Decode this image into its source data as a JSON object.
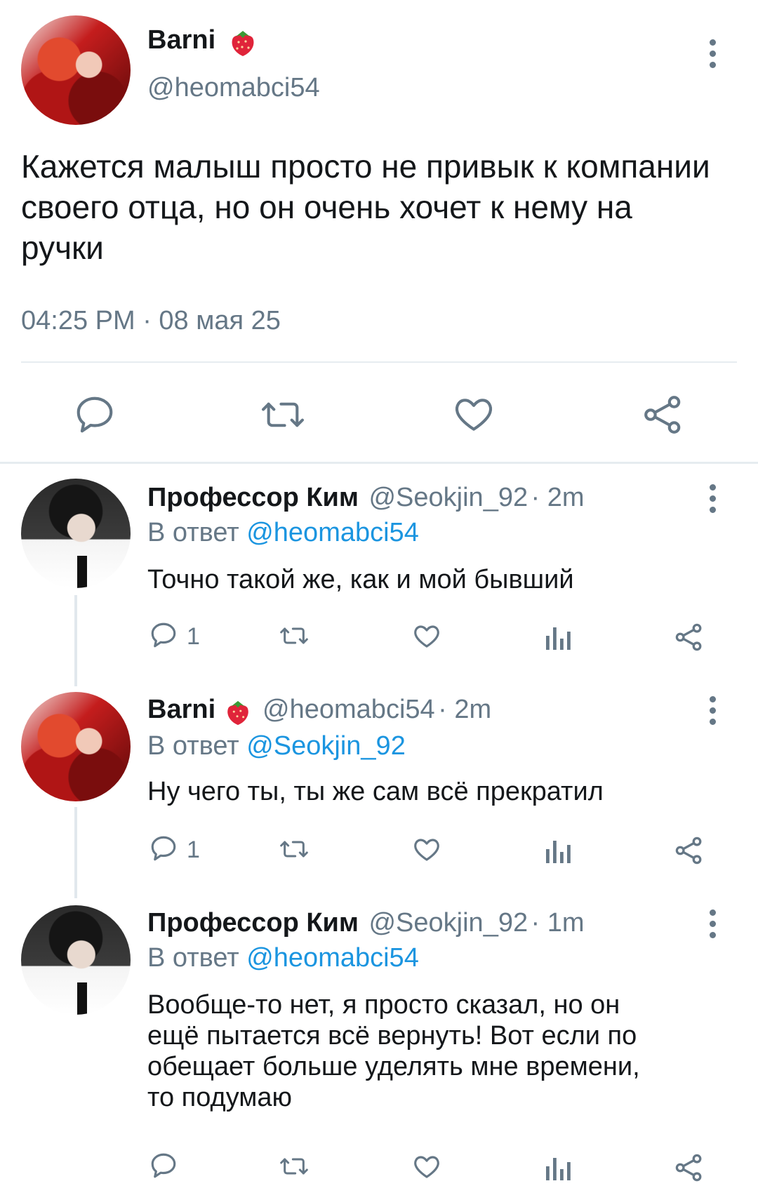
{
  "main_tweet": {
    "name": "Barni",
    "handle": "@heomabci54",
    "text": "Кажется малыш просто не привык к компании своего отца, но он очень хочет к нему на ручки",
    "timestamp": "04:25 PM · 08 мая 25",
    "icons": [
      "reply-icon",
      "retweet-icon",
      "like-icon",
      "share-icon"
    ]
  },
  "replies": [
    {
      "name": "Профессор Ким",
      "handle": "@Seokjin_92",
      "time": "· 2m",
      "reply_prefix": "В ответ",
      "reply_to": "@heomabci54",
      "text": "Точно такой же, как и мой бывший",
      "reply_count": "1"
    },
    {
      "name": "Barni",
      "handle": "@heomabci54",
      "time": "· 2m",
      "reply_prefix": "В ответ",
      "reply_to": "@Seokjin_92",
      "text": "Ну чего ты, ты же сам всё прекратил",
      "reply_count": "1"
    },
    {
      "name": "Профессор Ким",
      "handle": "@Seokjin_92",
      "time": "· 1m",
      "reply_prefix": "В ответ",
      "reply_to": "@heomabci54",
      "text_lines": [
        "Вообще-то нет, я просто сказал, но он",
        "ещё пытается всё вернуть! Вот если по",
        "обещает больше уделять мне времени,",
        "то подумаю"
      ],
      "reply_count": ""
    }
  ],
  "colors": {
    "link": "#1b95e0",
    "muted": "#657786",
    "divider": "#e6ecf0"
  }
}
